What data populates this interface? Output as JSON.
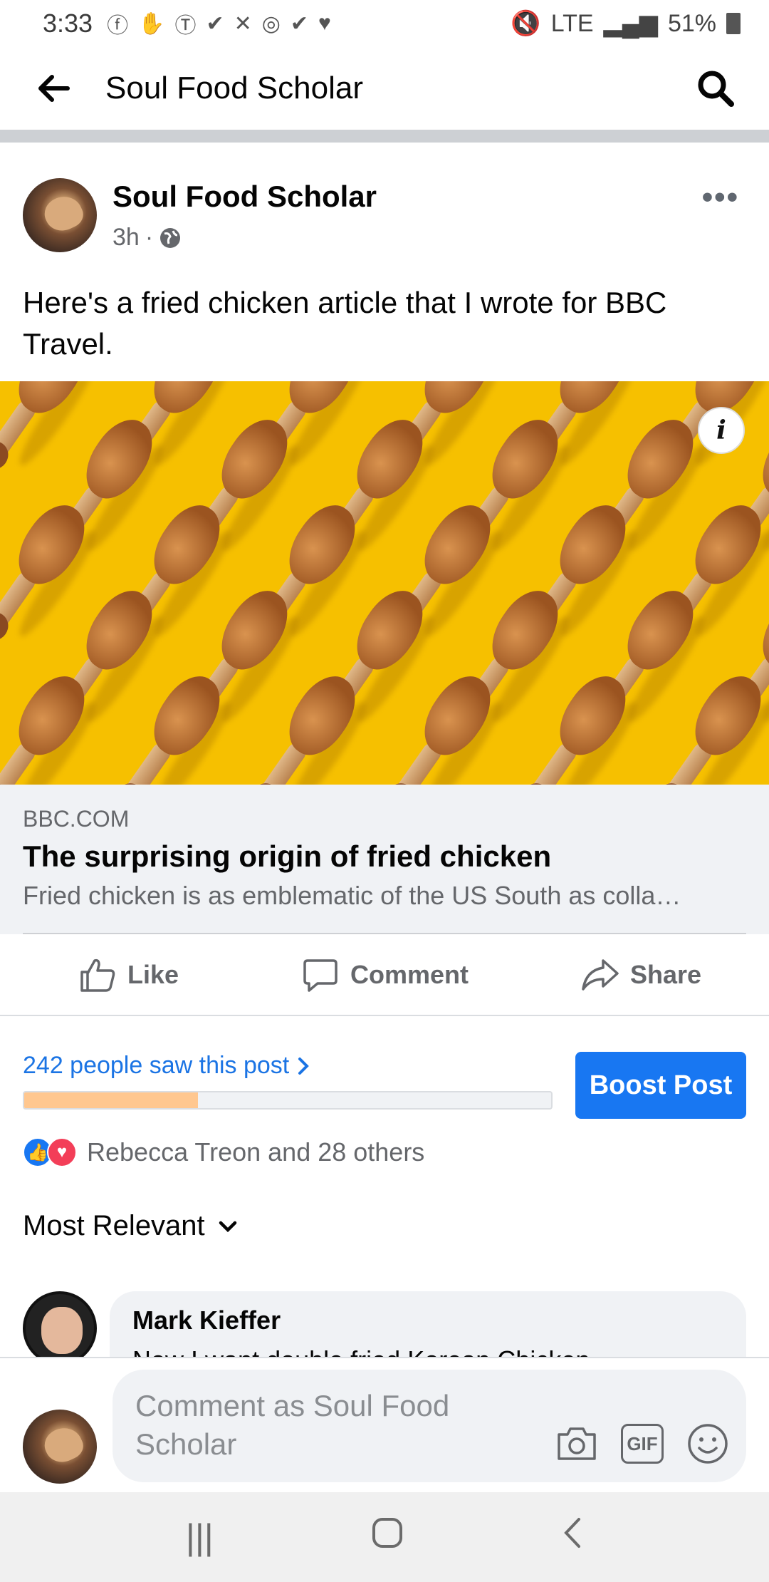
{
  "status_bar": {
    "time": "3:33",
    "network": "LTE",
    "battery": "51%"
  },
  "header": {
    "title": "Soul Food Scholar",
    "back_icon": "arrow-left-icon",
    "search_icon": "search-icon"
  },
  "post": {
    "author": "Soul Food Scholar",
    "time": "3h",
    "privacy_icon": "globe-icon",
    "text": "Here's a fried chicken article that I wrote for BBC Travel.",
    "link": {
      "domain": "BBC.COM",
      "title": "The surprising origin of fried chicken",
      "description": "Fried chicken is as emblematic of the US South as colla…"
    },
    "image_bg": "#f6c000"
  },
  "actions": {
    "like": "Like",
    "comment": "Comment",
    "share": "Share"
  },
  "insights": {
    "reach_text": "242 people saw this post",
    "reach_fraction": 0.33,
    "boost_label": "Boost Post"
  },
  "reactions": {
    "text": "Rebecca Treon and 28 others"
  },
  "comments": {
    "sort_label": "Most Relevant",
    "items": [
      {
        "name": "Mark Kieffer",
        "text": "Now I want double fried Korean Chicken"
      }
    ]
  },
  "composer": {
    "placeholder": "Comment as Soul Food Scholar"
  },
  "colors": {
    "accent": "#1877f2",
    "reach_fill": "#ffc78f",
    "love": "#f33e58"
  }
}
